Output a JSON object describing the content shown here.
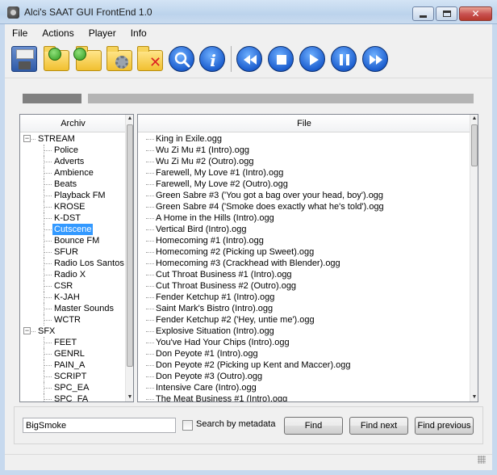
{
  "window": {
    "title": "Alci's SAAT GUI FrontEnd 1.0",
    "close_glyph": "✕"
  },
  "menu": [
    "File",
    "Actions",
    "Player",
    "Info"
  ],
  "toolbar": {
    "icons": [
      "save-icon",
      "folder-refresh-icon",
      "folder-forward-icon",
      "folder-settings-icon",
      "folder-delete-icon",
      "search-icon",
      "info-icon",
      "rewind-icon",
      "stop-icon",
      "play-icon",
      "pause-icon",
      "fast-forward-icon"
    ]
  },
  "progress": {
    "main_fraction": 0.0
  },
  "tree": {
    "header": "Archiv",
    "items": [
      {
        "label": "STREAM",
        "level": 0,
        "expander": "−"
      },
      {
        "label": "Police",
        "level": 1
      },
      {
        "label": "Adverts",
        "level": 1
      },
      {
        "label": "Ambience",
        "level": 1
      },
      {
        "label": "Beats",
        "level": 1
      },
      {
        "label": "Playback FM",
        "level": 1
      },
      {
        "label": "KROSE",
        "level": 1
      },
      {
        "label": "K-DST",
        "level": 1
      },
      {
        "label": "Cutscene",
        "level": 1,
        "selected": true
      },
      {
        "label": "Bounce FM",
        "level": 1
      },
      {
        "label": "SFUR",
        "level": 1
      },
      {
        "label": "Radio Los Santos",
        "level": 1
      },
      {
        "label": "Radio X",
        "level": 1
      },
      {
        "label": "CSR",
        "level": 1
      },
      {
        "label": "K-JAH",
        "level": 1
      },
      {
        "label": "Master Sounds",
        "level": 1
      },
      {
        "label": "WCTR",
        "level": 1
      },
      {
        "label": "SFX",
        "level": 0,
        "expander": "−"
      },
      {
        "label": "FEET",
        "level": 1
      },
      {
        "label": "GENRL",
        "level": 1
      },
      {
        "label": "PAIN_A",
        "level": 1
      },
      {
        "label": "SCRIPT",
        "level": 1
      },
      {
        "label": "SPC_EA",
        "level": 1
      },
      {
        "label": "SPC_FA",
        "level": 1
      }
    ]
  },
  "files": {
    "header": "File",
    "items": [
      "King in Exile.ogg",
      "Wu Zi Mu #1 (Intro).ogg",
      "Wu Zi Mu #2 (Outro).ogg",
      "Farewell, My Love #1 (Intro).ogg",
      "Farewell, My Love #2 (Outro).ogg",
      "Green Sabre #3 ('You got a bag over your head, boy').ogg",
      "Green Sabre #4 ('Smoke does exactly what he's told').ogg",
      "A Home in the Hills (Intro).ogg",
      "Vertical Bird (Intro).ogg",
      "Homecoming #1 (Intro).ogg",
      "Homecoming #2 (Picking up Sweet).ogg",
      "Homecoming #3 (Crackhead with Blender).ogg",
      "Cut Throat Business #1 (Intro).ogg",
      "Cut Throat Business #2 (Outro).ogg",
      "Fender Ketchup #1 (Intro).ogg",
      "Saint Mark's Bistro (Intro).ogg",
      "Fender Ketchup #2 ('Hey, untie me').ogg",
      "Explosive Situation (Intro).ogg",
      "You've Had Your Chips (Intro).ogg",
      "Don Peyote #1 (Intro).ogg",
      "Don Peyote #2 (Picking up Kent and Maccer).ogg",
      "Don Peyote #3 (Outro).ogg",
      "Intensive Care (Intro).ogg",
      "The Meat Business #1 (Intro).ogg"
    ]
  },
  "search": {
    "value": "BigSmoke",
    "checkbox_label": "Search by metadata",
    "checkbox_checked": false,
    "find_label": "Find",
    "find_next_label": "Find next",
    "find_previous_label": "Find previous"
  },
  "colors": {
    "selection": "#3399ff",
    "titlebar": "#bcd3ec"
  }
}
